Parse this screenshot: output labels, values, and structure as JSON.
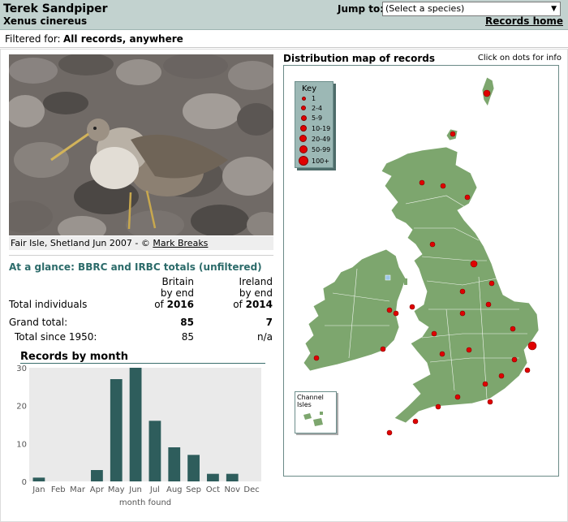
{
  "header": {
    "title": "Terek Sandpiper",
    "latin": "Xenus cinereus",
    "jump_label": "Jump to:",
    "species_select": "(Select a species)",
    "records_home": "Records home"
  },
  "filter": {
    "label": "Filtered for:",
    "value": "All records, anywhere"
  },
  "photo": {
    "caption_prefix": "Fair Isle, Shetland Jun 2007 - ©",
    "photographer": "Mark Breaks"
  },
  "totals": {
    "heading": "At a glance: BBRC and IRBC totals (unfiltered)",
    "britain_head": [
      "Britain",
      "by end",
      "of 2016"
    ],
    "ireland_head": [
      "Ireland",
      "by end",
      "of 2014"
    ],
    "row_total_individuals": "Total individuals",
    "row_grand_total": "Grand total:",
    "row_since_1950": "Total since 1950:",
    "britain_grand": "85",
    "ireland_grand": "7",
    "britain_since": "85",
    "ireland_since": "n/a"
  },
  "chart_title": "Records by month",
  "chart_data": {
    "type": "bar",
    "categories": [
      "Jan",
      "Feb",
      "Mar",
      "Apr",
      "May",
      "Jun",
      "Jul",
      "Aug",
      "Sep",
      "Oct",
      "Nov",
      "Dec"
    ],
    "values": [
      1,
      0,
      0,
      3,
      27,
      30,
      16,
      9,
      7,
      2,
      2,
      0
    ],
    "xlabel": "month found",
    "ylabel": "",
    "ylim": [
      0,
      30
    ],
    "yticks": [
      0,
      10,
      20,
      30
    ],
    "bar_color": "#2e5d5c",
    "grid": false
  },
  "map": {
    "title": "Distribution map of records",
    "hint": "Click on dots for info",
    "key_title": "Key",
    "key_items": [
      "1",
      "2-4",
      "5-9",
      "10-19",
      "20-49",
      "50-99",
      "100+"
    ],
    "channel_label": "Channel Isles",
    "land_color": "#7da66e",
    "dot_color": "#e00000"
  }
}
